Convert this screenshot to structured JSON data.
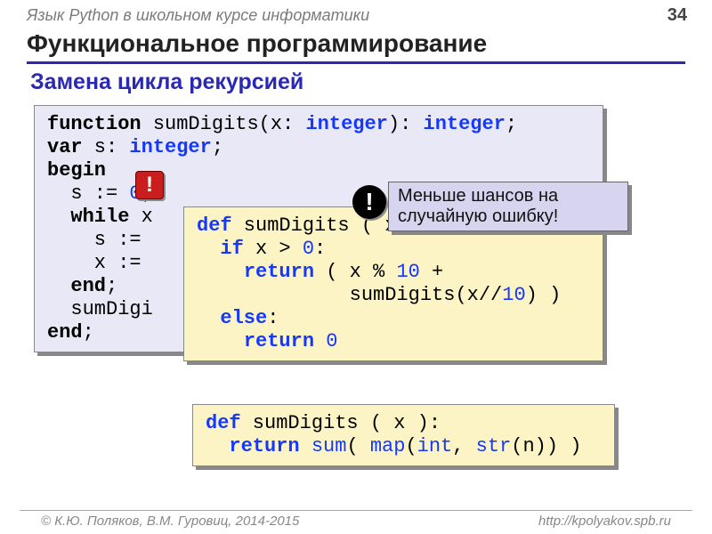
{
  "header": {
    "course": "Язык Python в школьном курсе информатики",
    "page": "34"
  },
  "title": "Функциональное программирование",
  "subtitle": "Замена цикла рекурсией",
  "badge_red": "!",
  "badge_black": "!",
  "note_text": "Меньше шансов на случайную ошибку!",
  "pascal": {
    "l1_kw": "function",
    "l1_name": " sumDigits(x: ",
    "l1_t1": "integer",
    "l1_mid": "): ",
    "l1_t2": "integer",
    "l1_end": ";",
    "l2_kw": "var",
    "l2_mid": " s: ",
    "l2_t": "integer",
    "l2_end": ";",
    "l3": "begin",
    "l4a": "  s := ",
    "l4n": "0",
    "l4b": ";",
    "l5a": "  ",
    "l5kw": "while",
    "l5b": " x",
    "l6": "    s :=",
    "l7": "    x :=",
    "l8a": "  ",
    "l8kw": "end",
    "l8b": ";",
    "l9": "  sumDigi",
    "l10": "end",
    "l10b": ";"
  },
  "py1": {
    "l1a": "def",
    "l1b": " sumDigits ( x ):",
    "l2a": "  ",
    "l2kw": "if",
    "l2b": " x > ",
    "l2n": "0",
    "l2c": ":",
    "l3a": "    ",
    "l3kw": "return",
    "l3b": " ( x % ",
    "l3n": "10",
    "l3c": " +",
    "l4": "             sumDigits(x//",
    "l4n": "10",
    "l4b": ") )",
    "l5a": "  ",
    "l5kw": "else",
    "l5b": ":",
    "l6a": "    ",
    "l6kw": "return",
    "l6b": " ",
    "l6n": "0"
  },
  "py2": {
    "l1a": "def",
    "l1b": " sumDigits ( x ):",
    "l2a": "  ",
    "l2kw": "return",
    "l2b": " ",
    "l2f1": "sum",
    "l2c": "( ",
    "l2f2": "map",
    "l2d": "(",
    "l2f3": "int",
    "l2e": ", ",
    "l2f4": "str",
    "l2f": "(n)) )"
  },
  "footer": {
    "left": "© К.Ю. Поляков, В.М. Гуровиц, 2014-2015",
    "right": "http://kpolyakov.spb.ru"
  }
}
